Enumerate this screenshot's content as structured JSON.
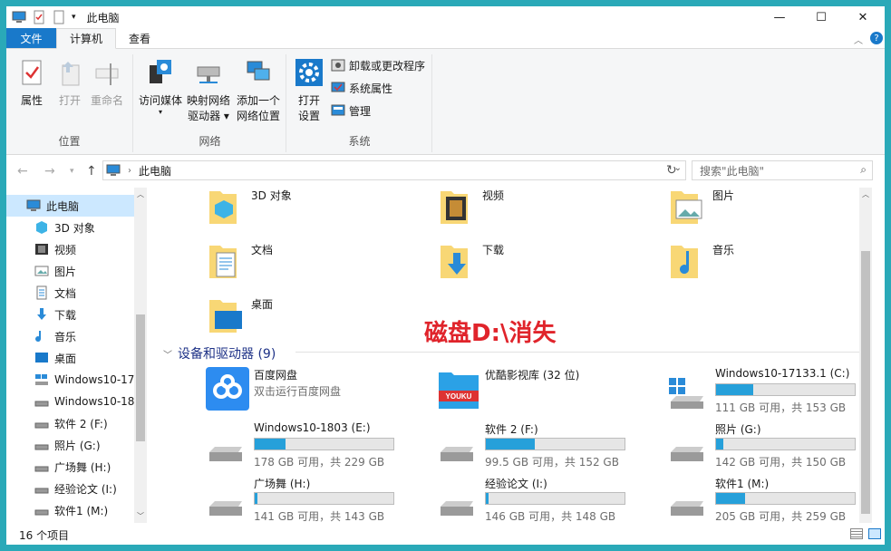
{
  "window": {
    "title": "此电脑",
    "minimize": "—",
    "maximize": "☐",
    "close": "✕"
  },
  "ribbon_tabs": [
    "文件",
    "计算机",
    "查看"
  ],
  "ribbon": {
    "groups": {
      "location": "位置",
      "network": "网络",
      "system": "系统"
    },
    "location": {
      "properties": "属性",
      "open": "打开",
      "rename": "重命名"
    },
    "network": {
      "media1": "访问媒体",
      "map1": "映射网络",
      "map2": "驱动器",
      "add1": "添加一个",
      "add2": "网络位置"
    },
    "system": {
      "open1": "打开",
      "open2": "设置",
      "uninstall": "卸载或更改程序",
      "sysprops": "系统属性",
      "manage": "管理"
    }
  },
  "address": {
    "path": "此电脑",
    "search_placeholder": "搜索\"此电脑\""
  },
  "sidebar": {
    "items": [
      "此电脑",
      "3D 对象",
      "视频",
      "图片",
      "文档",
      "下载",
      "音乐",
      "桌面",
      "Windows10-17",
      "Windows10-18",
      "软件 2 (F:)",
      "照片 (G:)",
      "广场舞 (H:)",
      "经验论文 (I:)",
      "软件1 (M:)"
    ]
  },
  "folders": [
    "3D 对象",
    "视频",
    "图片",
    "文档",
    "下载",
    "音乐",
    "桌面"
  ],
  "devices_header": "设备和驱动器 (9)",
  "overlay": "磁盘D:\\消失",
  "devices": [
    {
      "name": "百度网盘",
      "sub": "双击运行百度网盘",
      "type": "app"
    },
    {
      "name": "优酷影视库 (32 位)",
      "sub": "",
      "type": "app"
    },
    {
      "name": "Windows10-17133.1 (C:)",
      "cap": "111 GB 可用，共 153 GB",
      "used": 0.27
    },
    {
      "name": "Windows10-1803 (E:)",
      "cap": "178 GB 可用，共 229 GB",
      "used": 0.22
    },
    {
      "name": "软件 2 (F:)",
      "cap": "99.5 GB 可用，共 152 GB",
      "used": 0.35
    },
    {
      "name": "照片 (G:)",
      "cap": "142 GB 可用，共 150 GB",
      "used": 0.05
    },
    {
      "name": "广场舞 (H:)",
      "cap": "141 GB 可用，共 143 GB",
      "used": 0.02
    },
    {
      "name": "经验论文 (I:)",
      "cap": "146 GB 可用，共 148 GB",
      "used": 0.02
    },
    {
      "name": "软件1 (M:)",
      "cap": "205 GB 可用，共 259 GB",
      "used": 0.21
    }
  ],
  "status": {
    "count": "16 个项目"
  }
}
